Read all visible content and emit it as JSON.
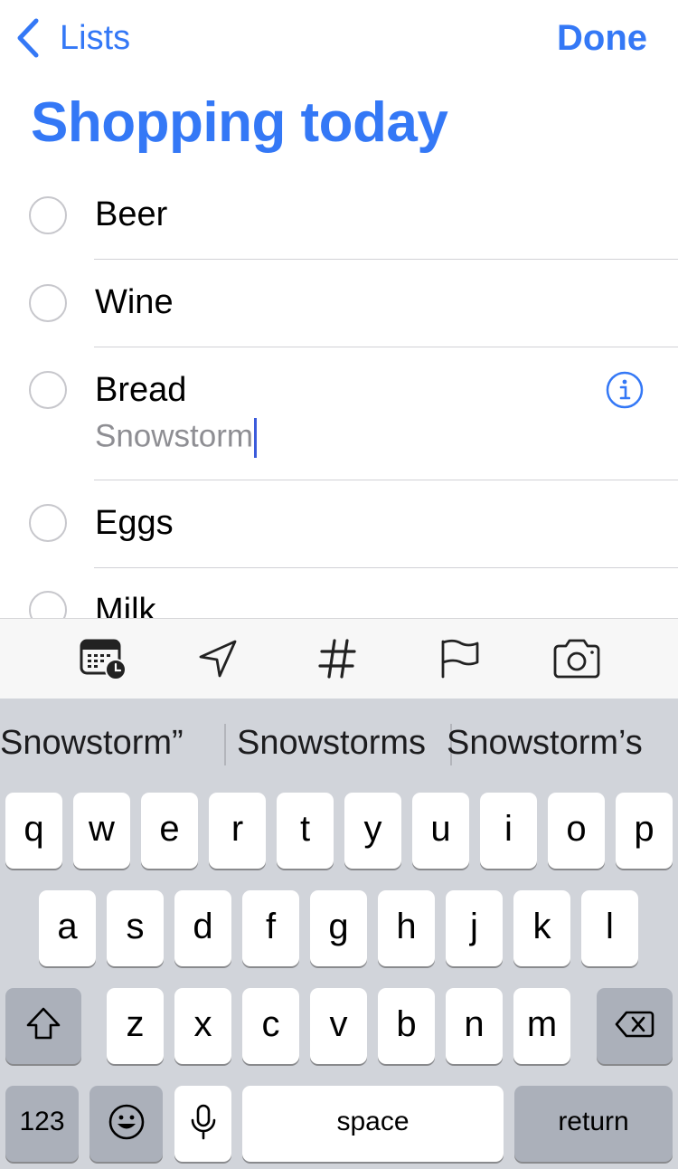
{
  "nav": {
    "back_label": "Lists",
    "done_label": "Done"
  },
  "list": {
    "title": "Shopping today",
    "items": [
      {
        "label": "Beer"
      },
      {
        "label": "Wine"
      },
      {
        "label": "Bread",
        "note": "Snowstorm"
      },
      {
        "label": "Eggs"
      },
      {
        "label": "Milk"
      }
    ]
  },
  "toolbar": {
    "items": [
      {
        "icon": "calendar-clock-icon"
      },
      {
        "icon": "location-arrow-icon"
      },
      {
        "icon": "hashtag-icon"
      },
      {
        "icon": "flag-icon"
      },
      {
        "icon": "camera-icon"
      }
    ]
  },
  "keyboard": {
    "suggestions": [
      "Snowstorm”",
      "Snowstorms",
      "Snowstorm’s"
    ],
    "rows": [
      [
        "q",
        "w",
        "e",
        "r",
        "t",
        "y",
        "u",
        "i",
        "o",
        "p"
      ],
      [
        "a",
        "s",
        "d",
        "f",
        "g",
        "h",
        "j",
        "k",
        "l"
      ],
      [
        "z",
        "x",
        "c",
        "v",
        "b",
        "n",
        "m"
      ]
    ],
    "numbers_label": "123",
    "space_label": "space",
    "return_label": "return"
  },
  "colors": {
    "accent": "#3478f6",
    "separator": "#d1d1d6",
    "keyboard_bg": "#d1d4da",
    "function_key": "#abb0ba"
  }
}
